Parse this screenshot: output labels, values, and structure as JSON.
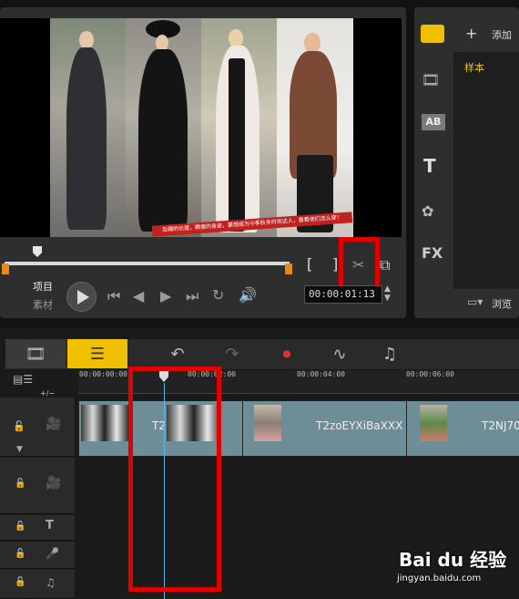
{
  "preview": {
    "caption": "及踝的长度，瞬瘦的身姿，要想成为今季秋冬时尚达人，看看他们怎么穿！",
    "mode_project": "项目",
    "mode_clip": "素材",
    "timecode": "00:00:01:13",
    "mark_in": "[",
    "mark_out": "]"
  },
  "library": {
    "add_label": "添加",
    "sample_label": "样本",
    "browse_label": "浏览",
    "side_icons": [
      "media-icon",
      "transition-icon",
      "title-icon",
      "text-icon",
      "graphics-icon",
      "fx-icon"
    ],
    "ab_label": "AB",
    "t_label": "T",
    "fx_label": "FX"
  },
  "timeline": {
    "add_remove": "+/−",
    "ruler": [
      "00:00:00:00",
      "00:00:02:00",
      "00:00:04:00",
      "00:00:06:00"
    ],
    "clips": [
      {
        "label": "T2"
      },
      {
        "label": "T2zoEYXiBaXXX"
      },
      {
        "label": "T2NJ70"
      }
    ]
  },
  "watermark": {
    "brand": "Bai du 经验",
    "url": "jingyan.baidu.com"
  },
  "colors": {
    "highlight": "#e00000",
    "accent_yellow": "#f0c000",
    "clip": "#6d8d97",
    "trim": "#e88a1a"
  }
}
